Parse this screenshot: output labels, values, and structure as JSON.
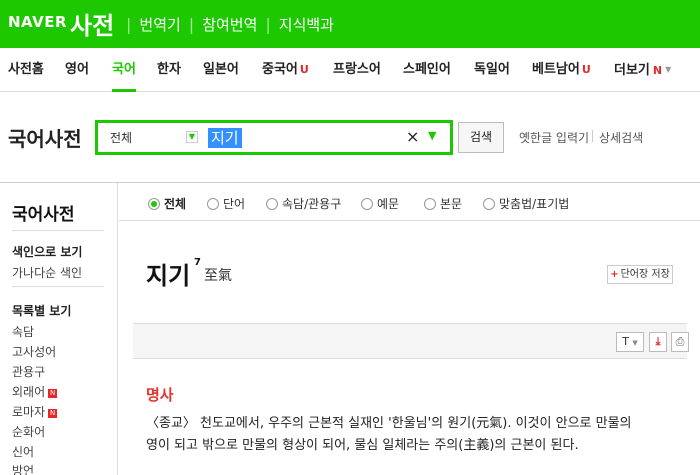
{
  "header": {
    "logo": "NAVER",
    "service": "사전",
    "links": [
      "번역기",
      "참여번역",
      "지식백과"
    ]
  },
  "lang_tabs": [
    {
      "label": "사전홈",
      "active": false,
      "badge": ""
    },
    {
      "label": "영어",
      "active": false,
      "badge": ""
    },
    {
      "label": "국어",
      "active": true,
      "badge": ""
    },
    {
      "label": "한자",
      "active": false,
      "badge": ""
    },
    {
      "label": "일본어",
      "active": false,
      "badge": ""
    },
    {
      "label": "중국어",
      "active": false,
      "badge": "U"
    },
    {
      "label": "프랑스어",
      "active": false,
      "badge": ""
    },
    {
      "label": "스페인어",
      "active": false,
      "badge": ""
    },
    {
      "label": "독일어",
      "active": false,
      "badge": ""
    },
    {
      "label": "베트남어",
      "active": false,
      "badge": "U"
    },
    {
      "label": "더보기",
      "active": false,
      "badge": "N"
    }
  ],
  "search": {
    "title": "국어사전",
    "scope": "전체",
    "query": "지기",
    "button": "검색",
    "old_hangul": "옛한글 입력기",
    "advanced": "상세검색"
  },
  "leftnav": {
    "title": "국어사전",
    "index_heading": "색인으로 보기",
    "index_item": "가나다순 색인",
    "list_heading": "목록별 보기",
    "list_items": [
      {
        "label": "속담",
        "new": false
      },
      {
        "label": "고사성어",
        "new": false
      },
      {
        "label": "관용구",
        "new": false
      },
      {
        "label": "외래어",
        "new": true
      },
      {
        "label": "로마자",
        "new": true
      },
      {
        "label": "순화어",
        "new": false
      },
      {
        "label": "신어",
        "new": false
      },
      {
        "label": "방언",
        "new": false
      }
    ],
    "new_badge": "N"
  },
  "filters": [
    {
      "label": "전체",
      "selected": true
    },
    {
      "label": "단어",
      "selected": false
    },
    {
      "label": "속담/관용구",
      "selected": false
    },
    {
      "label": "예문",
      "selected": false
    },
    {
      "label": "본문",
      "selected": false
    },
    {
      "label": "맞춤법/표기법",
      "selected": false
    }
  ],
  "entry": {
    "headword": "지기",
    "homonym": "7",
    "hanja": "至氣",
    "wordbook_button": "단어장 저장",
    "tools": {
      "font": "T"
    },
    "pos": "명사",
    "definition_line1": "〈종교〉 천도교에서, 우주의 근본적 실재인 '한울님'의 원기(元氣). 이것이 안으로 만물의",
    "definition_line2": "영이 되고 밖으로 만물의 형상이 되어, 물심 일체라는 주의(主義)의 근본이 된다."
  },
  "colors": {
    "brand": "#1ec800",
    "accent_red": "#e5332a",
    "selection": "#3390ff"
  }
}
